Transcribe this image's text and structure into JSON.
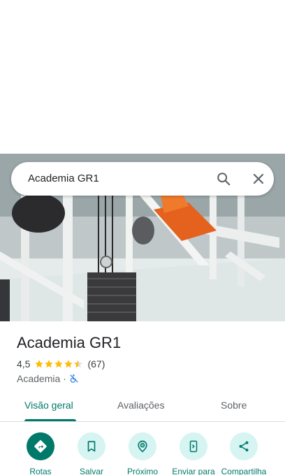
{
  "search": {
    "query": "Academia GR1"
  },
  "place": {
    "name": "Academia GR1",
    "rating": "4,5",
    "stars": 4.5,
    "reviews_count": "(67)",
    "category": "Academia",
    "separator": "·",
    "accessibility_icon": "no-wheelchair-icon"
  },
  "tabs": [
    {
      "label": "Visão geral",
      "active": true
    },
    {
      "label": "Avaliações",
      "active": false
    },
    {
      "label": "Sobre",
      "active": false
    }
  ],
  "actions": [
    {
      "label": "Rotas",
      "icon": "directions-icon"
    },
    {
      "label": "Salvar",
      "icon": "bookmark-icon"
    },
    {
      "label": "Próximo",
      "icon": "nearby-icon"
    },
    {
      "label": "Enviar para",
      "icon": "send-to-phone-icon"
    },
    {
      "label": "Compartilha",
      "icon": "share-icon"
    }
  ],
  "colors": {
    "accent": "#00796b",
    "star": "#fbbc04",
    "action_bg": "#d6f4f2"
  }
}
